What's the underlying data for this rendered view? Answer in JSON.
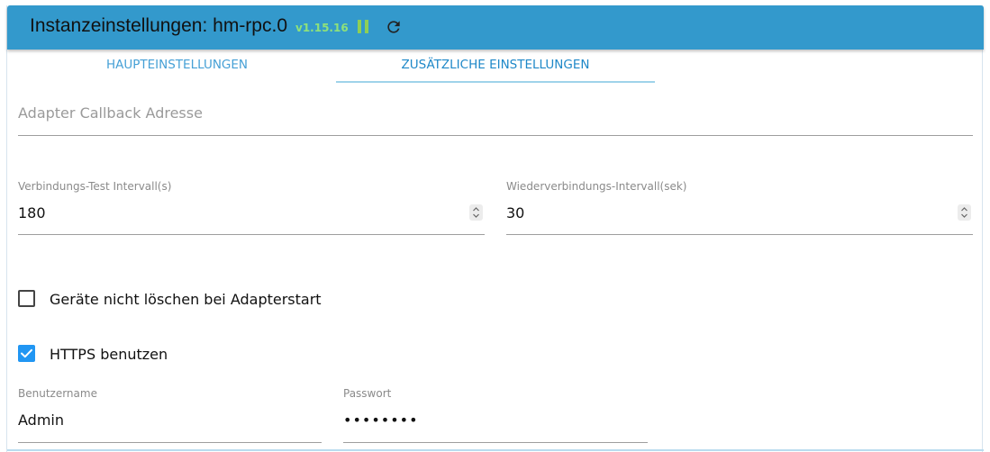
{
  "header": {
    "title": "Instanzeinstellungen: hm-rpc.0",
    "version": "v1.15.16",
    "pause_icon": "pause-icon",
    "reload_icon": "reload-icon",
    "accent_color": "#3399cc"
  },
  "tabs": [
    {
      "label": "Haupteinstellungen",
      "active": false
    },
    {
      "label": "Zusätzliche Einstellungen",
      "active": true
    }
  ],
  "fields": {
    "callback": {
      "placeholder": "Adapter Callback Adresse",
      "value": ""
    },
    "check_interval": {
      "label": "Verbindungs-Test Intervall(s)",
      "value": "180"
    },
    "reconnect_interval": {
      "label": "Wiederverbindungs-Intervall(sek)",
      "value": "30"
    },
    "username": {
      "label": "Benutzername",
      "value": "Admin"
    },
    "password": {
      "label": "Passwort",
      "value": "••••••••"
    }
  },
  "checkboxes": {
    "dont_delete": {
      "label": "Geräte nicht löschen bei Adapterstart",
      "checked": false
    },
    "use_https": {
      "label": "HTTPS benutzen",
      "checked": true
    }
  }
}
